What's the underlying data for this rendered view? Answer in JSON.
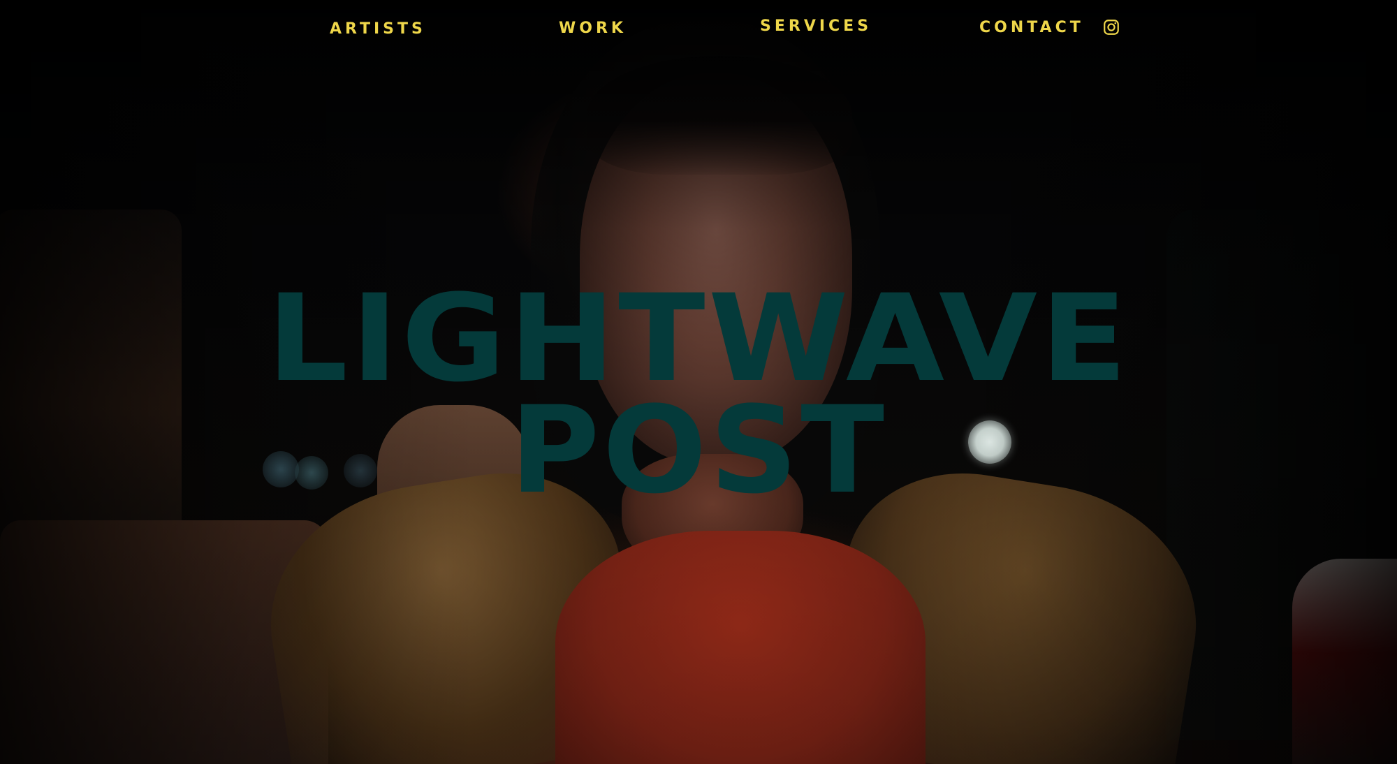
{
  "nav": {
    "items": [
      {
        "label": "ARTISTS"
      },
      {
        "label": "WORK"
      },
      {
        "label": "SERVICES"
      },
      {
        "label": "CONTACT"
      }
    ],
    "social_icon": "instagram-icon"
  },
  "hero": {
    "title_line_1": "LIGHTWAVE",
    "title_line_2": "POST"
  },
  "colors": {
    "nav_text": "#efd74a",
    "title_text": "#043a3a",
    "background": "#030303"
  }
}
